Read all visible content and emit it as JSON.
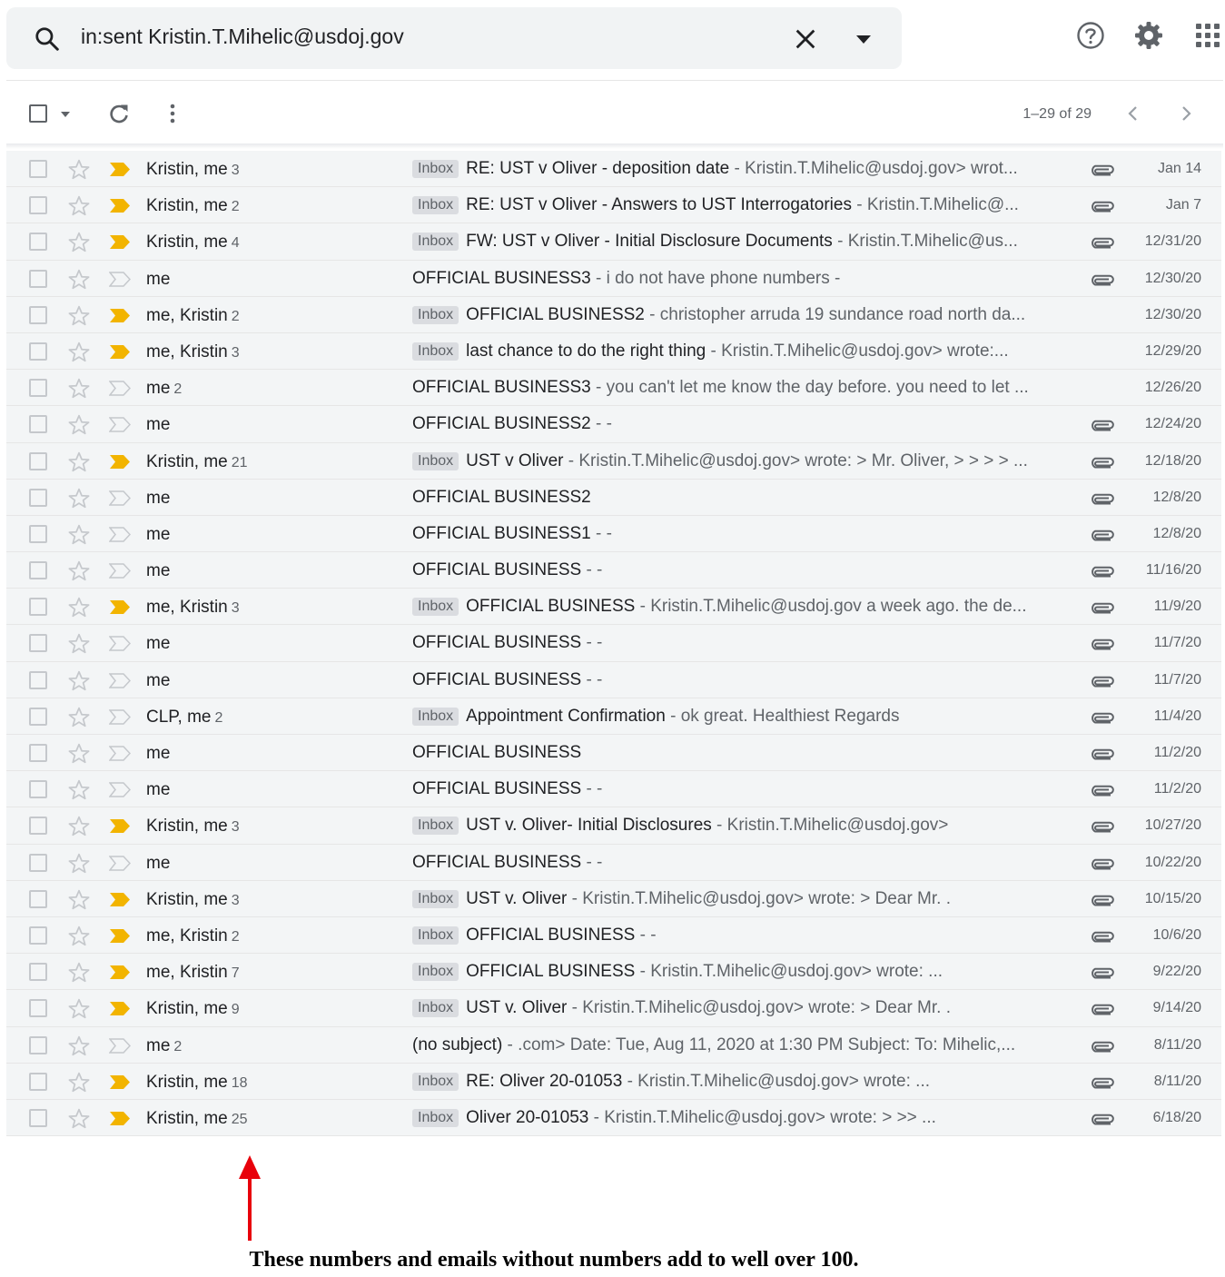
{
  "search": {
    "query": "in:sent Kristin.T.Mihelic@usdoj.gov"
  },
  "toolbar": {
    "pagination": "1–29 of 29"
  },
  "emails": [
    {
      "sender": "Kristin, me",
      "count": "3",
      "label": "Inbox",
      "subject": "RE: UST v Oliver - deposition date",
      "snippet": " - Kristin.T.Mihelic@usdoj.gov> wrot...",
      "attachment": true,
      "important": true,
      "date": "Jan 14"
    },
    {
      "sender": "Kristin, me",
      "count": "2",
      "label": "Inbox",
      "subject": "RE: UST v Oliver - Answers to UST Interrogatories",
      "snippet": " - Kristin.T.Mihelic@...",
      "attachment": true,
      "important": true,
      "date": "Jan 7"
    },
    {
      "sender": "Kristin, me",
      "count": "4",
      "label": "Inbox",
      "subject": "FW: UST v Oliver - Initial Disclosure Documents",
      "snippet": " - Kristin.T.Mihelic@us...",
      "attachment": true,
      "important": true,
      "date": "12/31/20"
    },
    {
      "sender": "me",
      "count": "",
      "label": "",
      "subject": "OFFICIAL BUSINESS3",
      "snippet": " - i do not have phone numbers -",
      "attachment": true,
      "important": false,
      "date": "12/30/20"
    },
    {
      "sender": "me, Kristin",
      "count": "2",
      "label": "Inbox",
      "subject": "OFFICIAL BUSINESS2",
      "snippet": " - christopher arruda 19 sundance road north da...",
      "attachment": false,
      "important": true,
      "date": "12/30/20"
    },
    {
      "sender": "me, Kristin",
      "count": "3",
      "label": "Inbox",
      "subject": "last chance to do the right thing",
      "snippet": " - Kristin.T.Mihelic@usdoj.gov> wrote:...",
      "attachment": false,
      "important": true,
      "date": "12/29/20"
    },
    {
      "sender": "me",
      "count": "2",
      "label": "",
      "subject": "OFFICIAL BUSINESS3",
      "snippet": " - you can't let me know the day before. you need to let ...",
      "attachment": false,
      "important": false,
      "date": "12/26/20"
    },
    {
      "sender": "me",
      "count": "",
      "label": "",
      "subject": "OFFICIAL BUSINESS2",
      "snippet": " - -",
      "attachment": true,
      "important": false,
      "date": "12/24/20"
    },
    {
      "sender": "Kristin, me",
      "count": "21",
      "label": "Inbox",
      "subject": "UST v Oliver",
      "snippet": " - Kristin.T.Mihelic@usdoj.gov> wrote: > Mr. Oliver, > > > > ...",
      "attachment": true,
      "important": true,
      "date": "12/18/20"
    },
    {
      "sender": "me",
      "count": "",
      "label": "",
      "subject": "OFFICIAL BUSINESS2",
      "snippet": "",
      "attachment": true,
      "important": false,
      "date": "12/8/20"
    },
    {
      "sender": "me",
      "count": "",
      "label": "",
      "subject": "OFFICIAL BUSINESS1",
      "snippet": " - -",
      "attachment": true,
      "important": false,
      "date": "12/8/20"
    },
    {
      "sender": "me",
      "count": "",
      "label": "",
      "subject": "OFFICIAL BUSINESS",
      "snippet": " - -",
      "attachment": true,
      "important": false,
      "date": "11/16/20"
    },
    {
      "sender": "me, Kristin",
      "count": "3",
      "label": "Inbox",
      "subject": "OFFICIAL BUSINESS",
      "snippet": " - Kristin.T.Mihelic@usdoj.gov a week ago. the de...",
      "attachment": true,
      "important": true,
      "date": "11/9/20"
    },
    {
      "sender": "me",
      "count": "",
      "label": "",
      "subject": "OFFICIAL BUSINESS",
      "snippet": " - -",
      "attachment": true,
      "important": false,
      "date": "11/7/20"
    },
    {
      "sender": "me",
      "count": "",
      "label": "",
      "subject": "OFFICIAL BUSINESS",
      "snippet": " - -",
      "attachment": true,
      "important": false,
      "date": "11/7/20"
    },
    {
      "sender": "CLP, me",
      "count": "2",
      "label": "Inbox",
      "subject": "Appointment Confirmation",
      "snippet": " - ok great. Healthiest Regards",
      "attachment": true,
      "important": false,
      "date": "11/4/20"
    },
    {
      "sender": "me",
      "count": "",
      "label": "",
      "subject": "OFFICIAL BUSINESS",
      "snippet": "",
      "attachment": true,
      "important": false,
      "date": "11/2/20"
    },
    {
      "sender": "me",
      "count": "",
      "label": "",
      "subject": "OFFICIAL BUSINESS",
      "snippet": " - -",
      "attachment": true,
      "important": false,
      "date": "11/2/20"
    },
    {
      "sender": "Kristin, me",
      "count": "3",
      "label": "Inbox",
      "subject": "UST v. Oliver- Initial Disclosures",
      "snippet": " - Kristin.T.Mihelic@usdoj.gov>",
      "attachment": true,
      "important": true,
      "date": "10/27/20"
    },
    {
      "sender": "me",
      "count": "",
      "label": "",
      "subject": "OFFICIAL BUSINESS",
      "snippet": " - -",
      "attachment": true,
      "important": false,
      "date": "10/22/20"
    },
    {
      "sender": "Kristin, me",
      "count": "3",
      "label": "Inbox",
      "subject": "UST v. Oliver",
      "snippet": " - Kristin.T.Mihelic@usdoj.gov> wrote: > Dear Mr. .",
      "attachment": true,
      "important": true,
      "date": "10/15/20"
    },
    {
      "sender": "me, Kristin",
      "count": "2",
      "label": "Inbox",
      "subject": "OFFICIAL BUSINESS",
      "snippet": " - -",
      "attachment": true,
      "important": true,
      "date": "10/6/20"
    },
    {
      "sender": "me, Kristin",
      "count": "7",
      "label": "Inbox",
      "subject": "OFFICIAL BUSINESS",
      "snippet": " - Kristin.T.Mihelic@usdoj.gov> wrote: ...",
      "attachment": true,
      "important": true,
      "date": "9/22/20"
    },
    {
      "sender": "Kristin, me",
      "count": "9",
      "label": "Inbox",
      "subject": "UST v. Oliver",
      "snippet": " - Kristin.T.Mihelic@usdoj.gov> wrote: > Dear Mr. .",
      "attachment": true,
      "important": true,
      "date": "9/14/20"
    },
    {
      "sender": "me",
      "count": "2",
      "label": "",
      "subject": "(no subject)",
      "snippet": " - .com> Date: Tue, Aug 11, 2020 at 1:30 PM Subject: To: Mihelic,...",
      "attachment": true,
      "important": false,
      "date": "8/11/20"
    },
    {
      "sender": "Kristin, me",
      "count": "18",
      "label": "Inbox",
      "subject": "RE: Oliver 20-01053",
      "snippet": " - Kristin.T.Mihelic@usdoj.gov> wrote: ...",
      "attachment": true,
      "important": true,
      "date": "8/11/20"
    },
    {
      "sender": "Kristin, me",
      "count": "25",
      "label": "Inbox",
      "subject": "Oliver 20-01053",
      "snippet": " - Kristin.T.Mihelic@usdoj.gov> wrote: > >> ...",
      "attachment": true,
      "important": true,
      "date": "6/18/20"
    }
  ],
  "annotation": {
    "text": "These numbers and emails without numbers add to well over 100.",
    "arrow_color": "#e8000b"
  },
  "colors": {
    "important_marker": "#f2b400",
    "row_background": "#f3f5f6"
  }
}
